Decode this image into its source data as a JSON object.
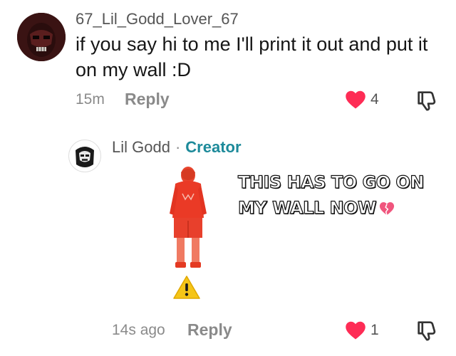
{
  "comment": {
    "username": "67_Lil_Godd_Lover_67",
    "text": "if you say hi to me I'll print it out and put it on my wall :D",
    "timestamp": "15m",
    "reply_label": "Reply",
    "like_count": "4",
    "liked": true,
    "avatar_icon": "masked-face-avatar"
  },
  "reply": {
    "username": "Lil Godd",
    "separator": "·",
    "badge": "Creator",
    "caption_line1": "THIS HAS TO GO ON",
    "caption_line2": "MY WALL NOW",
    "caption_emoji": "broken-heart-icon",
    "sticker": "red-hoodie-figure-sticker",
    "warning_icon": "warning-icon",
    "timestamp": "14s ago",
    "reply_label": "Reply",
    "like_count": "1",
    "liked": true,
    "avatar_icon": "masked-face-avatar"
  },
  "colors": {
    "like_red": "#fe2c55",
    "creator_teal": "#1d8a9a",
    "muted_text": "#8a8a8a"
  }
}
